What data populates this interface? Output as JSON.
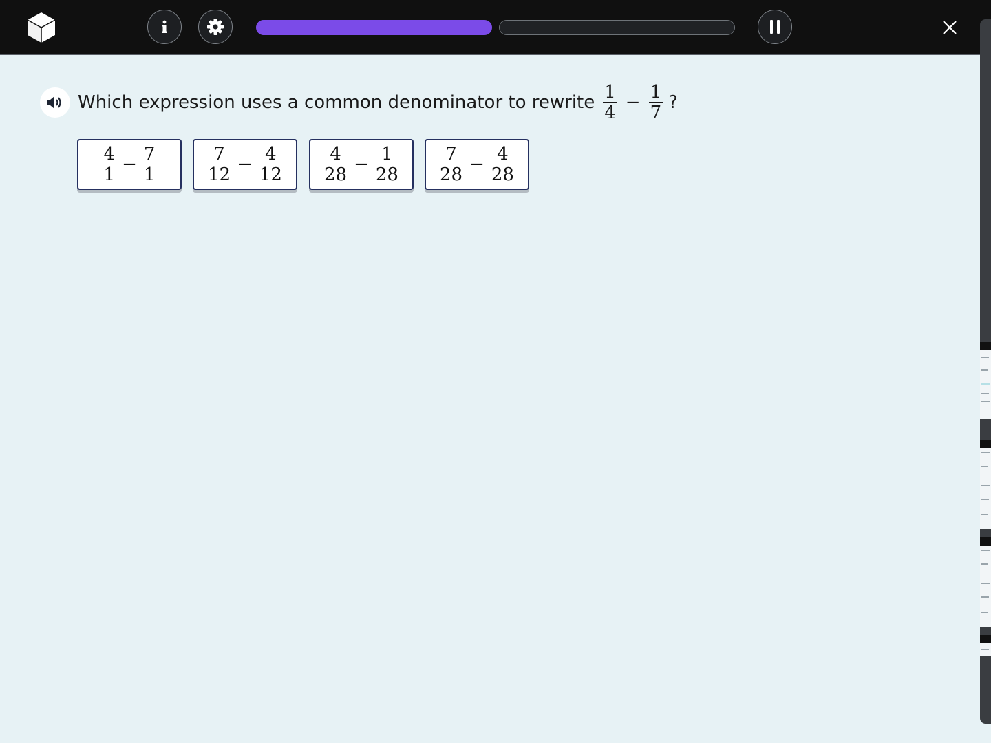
{
  "app": {
    "brand_color": "#ffffff",
    "accent_color": "#7b4be8"
  },
  "toolbar": {
    "info_icon": "info-icon",
    "settings_icon": "gear-icon",
    "pause_icon": "pause-icon",
    "close_icon": "close-icon",
    "progress_segments": [
      {
        "fill_fraction": 1.0,
        "color": "#7b4be8"
      },
      {
        "fill_fraction": 0.0,
        "color": "#7b4be8"
      }
    ]
  },
  "question": {
    "audio_icon": "speaker-icon",
    "prompt_text": "Which expression uses a common denominator to rewrite",
    "expression": {
      "left": {
        "numerator": "1",
        "denominator": "4"
      },
      "operator": "−",
      "right": {
        "numerator": "1",
        "denominator": "7"
      }
    },
    "suffix": "?"
  },
  "choices": [
    {
      "left": {
        "numerator": "4",
        "denominator": "1"
      },
      "operator": "−",
      "right": {
        "numerator": "7",
        "denominator": "1"
      }
    },
    {
      "left": {
        "numerator": "7",
        "denominator": "12"
      },
      "operator": "−",
      "right": {
        "numerator": "4",
        "denominator": "12"
      }
    },
    {
      "left": {
        "numerator": "4",
        "denominator": "28"
      },
      "operator": "−",
      "right": {
        "numerator": "1",
        "denominator": "28"
      }
    },
    {
      "left": {
        "numerator": "7",
        "denominator": "28"
      },
      "operator": "−",
      "right": {
        "numerator": "4",
        "denominator": "28"
      }
    }
  ]
}
